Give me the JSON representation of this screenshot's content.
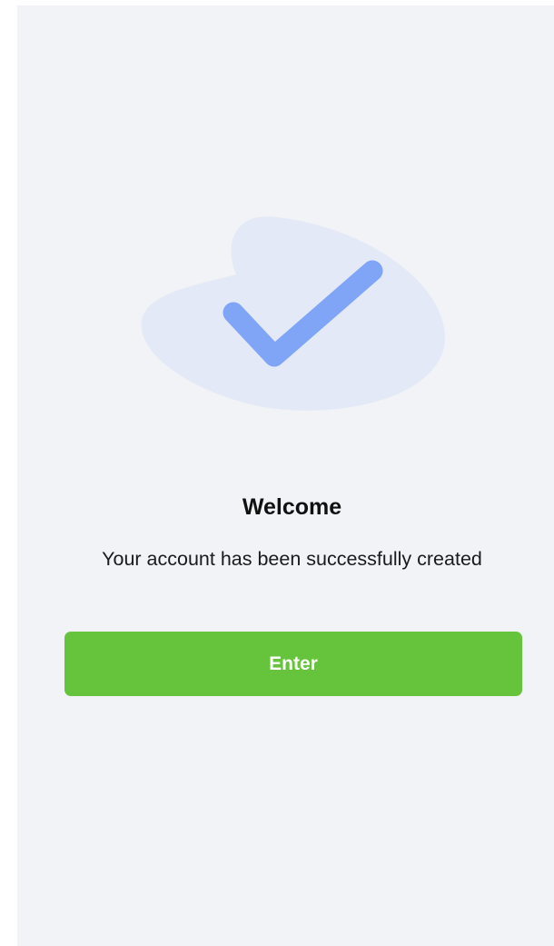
{
  "success": {
    "icon": "checkmark-icon",
    "title": "Welcome",
    "message": "Your account has been successfully created",
    "enter_label": "Enter"
  },
  "colors": {
    "screen_background": "#f1f3f7",
    "blob": "#e3e9f6",
    "checkmark": "#80a4f6",
    "button": "#65c43c",
    "button_text": "#ffffff"
  }
}
